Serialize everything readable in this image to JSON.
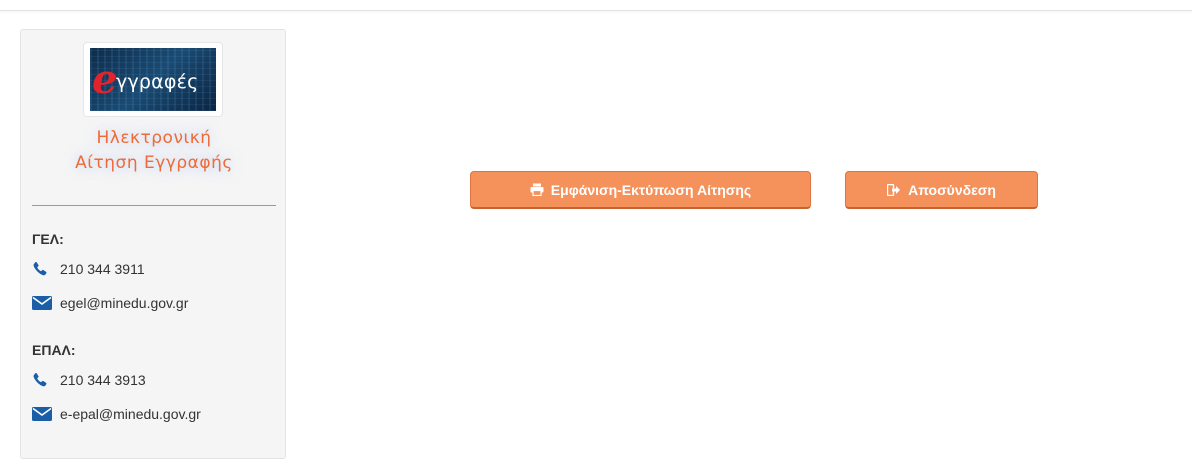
{
  "logo": {
    "e_letter": "e",
    "wordmark": "γγραφές"
  },
  "app_title": {
    "line1": "Ηλεκτρονική",
    "line2": "Αίτηση Εγγραφής"
  },
  "contacts": [
    {
      "title": "ΓΕΛ:",
      "phone": "210 344 3911",
      "email": "egel@minedu.gov.gr"
    },
    {
      "title": "ΕΠΑΛ:",
      "phone": "210 344 3913",
      "email": "e-epal@minedu.gov.gr"
    }
  ],
  "actions": {
    "print_label": "Εμφάνιση-Εκτύπωση Αίτησης",
    "logout_label": "Αποσύνδεση"
  },
  "colors": {
    "accent_button": "#f5915a",
    "title_orange": "#ef6a35",
    "icon_blue": "#1a5ea8"
  }
}
